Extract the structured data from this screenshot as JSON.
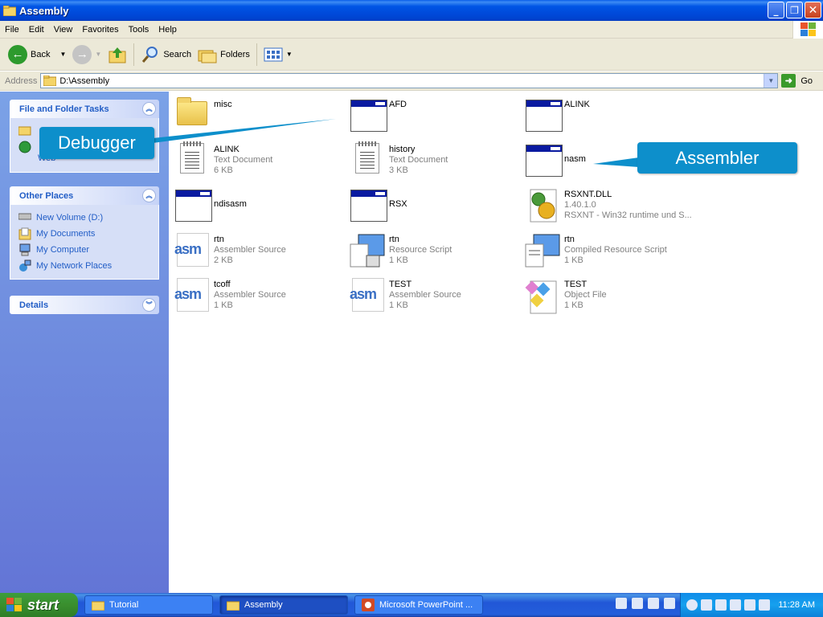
{
  "window": {
    "title": "Assembly"
  },
  "menu": [
    "File",
    "Edit",
    "View",
    "Favorites",
    "Tools",
    "Help"
  ],
  "toolbar": {
    "back": "Back",
    "search": "Search",
    "folders": "Folders"
  },
  "address": {
    "label": "Address",
    "path": "D:\\Assembly",
    "go": "Go"
  },
  "left": {
    "tasks_title": "File and Folder Tasks",
    "tasks_partial": "Web",
    "places_title": "Other Places",
    "places": [
      "New Volume (D:)",
      "My Documents",
      "My Computer",
      "My Network Places"
    ],
    "details_title": "Details"
  },
  "files": [
    {
      "name": "misc",
      "type": "",
      "size": ""
    },
    {
      "name": "AFD",
      "type": "",
      "size": ""
    },
    {
      "name": "ALINK",
      "type": "",
      "size": ""
    },
    {
      "name": "ALINK",
      "type": "Text Document",
      "size": "6 KB"
    },
    {
      "name": "history",
      "type": "Text Document",
      "size": "3 KB"
    },
    {
      "name": "nasm",
      "type": "",
      "size": ""
    },
    {
      "name": "ndisasm",
      "type": "",
      "size": ""
    },
    {
      "name": "RSX",
      "type": "",
      "size": ""
    },
    {
      "name": "RSXNT.DLL",
      "type": "1.40.1.0",
      "size": "RSXNT - Win32 runtime und S..."
    },
    {
      "name": "rtn",
      "type": "Assembler Source",
      "size": "2 KB"
    },
    {
      "name": "rtn",
      "type": "Resource Script",
      "size": "1 KB"
    },
    {
      "name": "rtn",
      "type": "Compiled Resource Script",
      "size": "1 KB"
    },
    {
      "name": "tcoff",
      "type": "Assembler Source",
      "size": "1 KB"
    },
    {
      "name": "TEST",
      "type": "Assembler Source",
      "size": "1 KB"
    },
    {
      "name": "TEST",
      "type": "Object File",
      "size": "1 KB"
    }
  ],
  "icons": {
    "asm_text": "asm"
  },
  "callouts": {
    "debugger": "Debugger",
    "assembler": "Assembler"
  },
  "taskbar": {
    "start": "start",
    "tasks": [
      "Tutorial",
      "Assembly",
      "Microsoft PowerPoint ..."
    ],
    "clock": "11:28 AM"
  },
  "colors": {
    "callout": "#0d8fcb",
    "titlebar": "#0055e5",
    "leftpane": "#7ba2e7"
  }
}
